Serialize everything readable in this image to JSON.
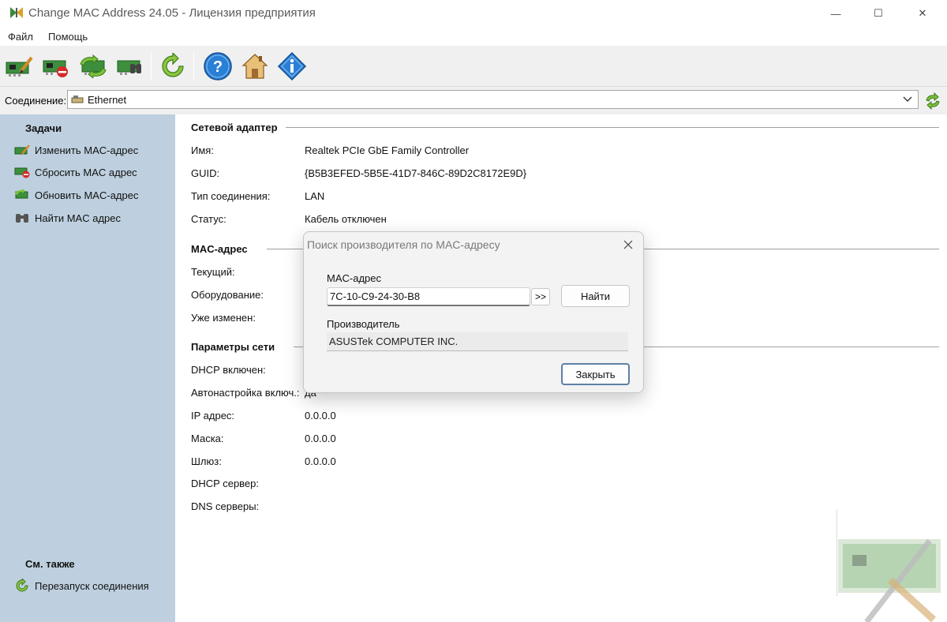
{
  "window": {
    "title": "Change MAC Address 24.05 - Лицензия предприятия",
    "minimize_glyph": "—",
    "maximize_glyph": "☐",
    "close_glyph": "✕"
  },
  "menu": {
    "items": [
      "Файл",
      "Помощь"
    ]
  },
  "toolbar": {
    "buttons": [
      "change-mac-icon",
      "reset-mac-icon",
      "update-mac-icon",
      "find-mac-icon",
      "restart-connection-icon",
      "help-icon",
      "home-icon",
      "about-icon"
    ]
  },
  "connection": {
    "label": "Соединение:",
    "value": "Ethernet"
  },
  "tasks": {
    "heading": "Задачи",
    "items": [
      "Изменить MAC-адрес",
      "Сбросить MAC адрес",
      "Обновить MAC-адрес",
      "Найти MAC адрес"
    ]
  },
  "see_also": {
    "heading": "См. также",
    "items": [
      "Перезапуск соединения"
    ]
  },
  "adapter": {
    "heading": "Сетевой адаптер",
    "rows": [
      {
        "label": "Имя:",
        "value": "Realtek PCIe GbE Family Controller"
      },
      {
        "label": "GUID:",
        "value": "{B5B3EFED-5B5E-41D7-846C-89D2C8172E9D}"
      },
      {
        "label": "Тип соединения:",
        "value": "LAN"
      },
      {
        "label": "Статус:",
        "value": "Кабель отключен"
      }
    ]
  },
  "mac": {
    "heading": "MAC-адрес",
    "rows": [
      {
        "label": "Текущий:",
        "value": ""
      },
      {
        "label": "Оборудование:",
        "value": ""
      },
      {
        "label": "Уже изменен:",
        "value": ""
      }
    ]
  },
  "network": {
    "heading": "Параметры сети",
    "rows": [
      {
        "label": "DHCP включен:",
        "value": ""
      },
      {
        "label": "Автонастройка включ.:",
        "value": "да"
      },
      {
        "label": "IP адрес:",
        "value": "0.0.0.0"
      },
      {
        "label": "Маска:",
        "value": "0.0.0.0"
      },
      {
        "label": "Шлюз:",
        "value": "0.0.0.0"
      },
      {
        "label": "DHCP сервер:",
        "value": ""
      },
      {
        "label": "DNS серверы:",
        "value": ""
      }
    ]
  },
  "dialog": {
    "title": "Поиск производителя по MAC-адресу",
    "mac_label": "MAC-адрес",
    "mac_value": "7C-10-C9-24-30-B8",
    "arrow_button": ">>",
    "find_button": "Найти",
    "vendor_label": "Производитель",
    "vendor_value": "ASUSTek COMPUTER INC.",
    "close_button": "Закрыть"
  }
}
